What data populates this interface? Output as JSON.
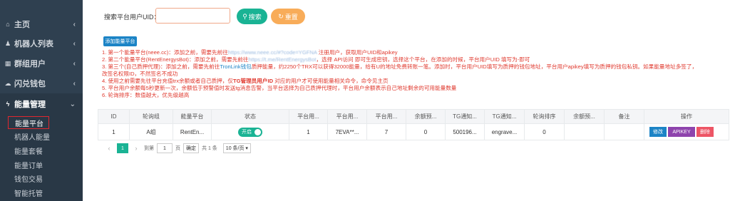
{
  "sidebar": {
    "items": [
      {
        "label": "主页",
        "icon": "home-icon",
        "glyph": "⌂"
      },
      {
        "label": "机器人列表",
        "icon": "users-icon",
        "glyph": "♟"
      },
      {
        "label": "群组用户",
        "icon": "group-icon",
        "glyph": "▦"
      },
      {
        "label": "闪兑钱包",
        "icon": "cloud-icon",
        "glyph": "☁"
      },
      {
        "label": "能量管理",
        "icon": "bolt-icon",
        "glyph": "ϟ"
      }
    ],
    "submenu": [
      "能量平台",
      "机器人能量",
      "能量套餐",
      "能量订单",
      "钱包交易",
      "智能托管"
    ]
  },
  "search": {
    "label": "搜索平台用户UID：",
    "input_value": "",
    "search_label": "搜索",
    "reset_label": "重置",
    "search_glyph": "⚲",
    "reset_glyph": "↻"
  },
  "toolbar": {
    "add_label": "添加能量平台"
  },
  "notes": {
    "n1a": "1. 第一个能量平台(neee.cc)：添加之前，需要先前往",
    "n1b": "https://www.neee.cc/#?code=YGFNA",
    "n1c": " 注册用户，获取用户UID和apikey",
    "n2a": "2. 第二个能量平台(RentEnergysBot)：添加之前，需要先前往",
    "n2b": "https://t.me/RentEnergysBot",
    "n2c": "，选择 API访问 即可生成密钥，选择这个平台，在添加的时候，平台用户UID 填写为-即可",
    "n3a": "3. 第三个(自己质押代理)：添加之前，需要先前往",
    "n3b": "TronLink钱包",
    "n3c": "质押能量，约2250个TRX可以获得32000能量，给有U的地址免费转账一笔。添加时，平台用户UID填写为质押的钱包地址，平台用户apikey填写为质押的钱包私钥。如果能量地址多签了，",
    "n3d": "改签名权限ID，不然签名不成功",
    "n4a": "4. 使用之前需要先往平台充值trx余额或者自己质押，仅",
    "n4b": "TG管理员用户ID",
    "n4c": " 对应的用户才可使用能量相关命令，命令见主页",
    "n5": "5. 平台用户余额每5秒更新一次，余额低于预警值时发送tg消息告警，当平台选择为自己质押代理时，平台用户余额表示自己地址剩余的可用能量数量",
    "n6": "6. 轮询排序：数值越大，优先级越高"
  },
  "table": {
    "headers": [
      "ID",
      "轮询组",
      "能量平台",
      "状态",
      "平台用...",
      "平台用...",
      "平台用...",
      "余额预...",
      "TG通知...",
      "TG通知...",
      "轮询排序",
      "余额预...",
      "备注",
      "操作"
    ],
    "row": {
      "id": "1",
      "group": "A组",
      "platform": "RentEn...",
      "status": "开启",
      "c4": "1",
      "c5": "7EVA**...",
      "c6": "7",
      "c7": "0",
      "c8": "500196...",
      "c9": "engrave...",
      "c10": "0",
      "c11": "",
      "c12": ""
    },
    "actions": {
      "edit": "修改",
      "apikey": "APIKEY",
      "delete": "删除"
    }
  },
  "pager": {
    "prev": "‹",
    "current": "1",
    "next": "›",
    "goto_label": "到第",
    "page_input": "1",
    "page_unit": "页",
    "confirm": "确定",
    "total": "共 1 条",
    "per_page": "10 条/页 ▾"
  },
  "colors": {
    "sidebar": "#2f4050",
    "primary": "#1ab394",
    "warning": "#f8ac59",
    "info": "#1c84c6",
    "danger": "#ed5565",
    "note_red": "#e03a2f"
  }
}
